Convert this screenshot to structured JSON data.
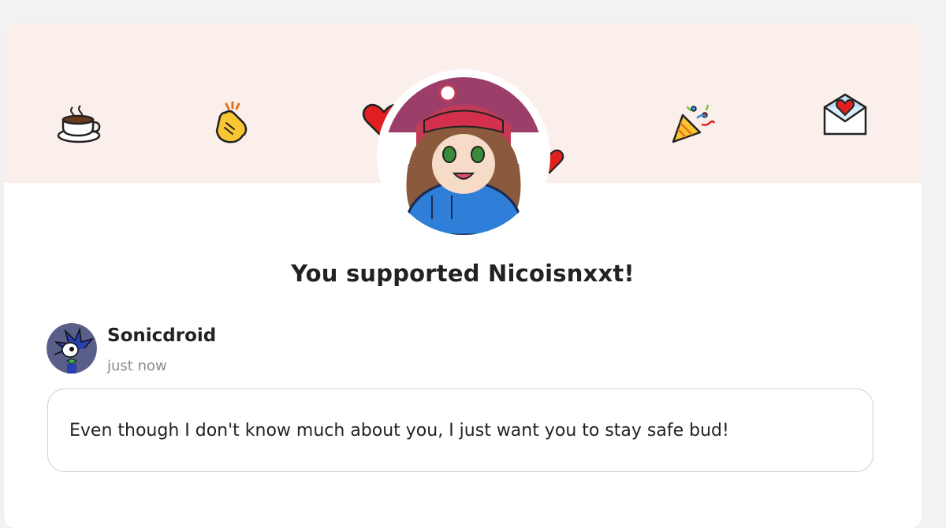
{
  "banner": {
    "icons": [
      "coffee-cup-icon",
      "clapping-hands-icon",
      "heart-icon",
      "party-popper-icon",
      "love-letter-icon"
    ],
    "background": "#fbefeb"
  },
  "creator": {
    "avatar": "creator-avatar"
  },
  "headline": "You supported Nicoisnxxt!",
  "supporter": {
    "name": "Sonicdroid",
    "time": "just now",
    "avatar": "supporter-avatar"
  },
  "message": "Even though I don't know much about you, I just want you to stay safe bud!",
  "colors": {
    "text": "#222222",
    "muted": "#8a8a8a",
    "border": "#cfcfcf"
  }
}
